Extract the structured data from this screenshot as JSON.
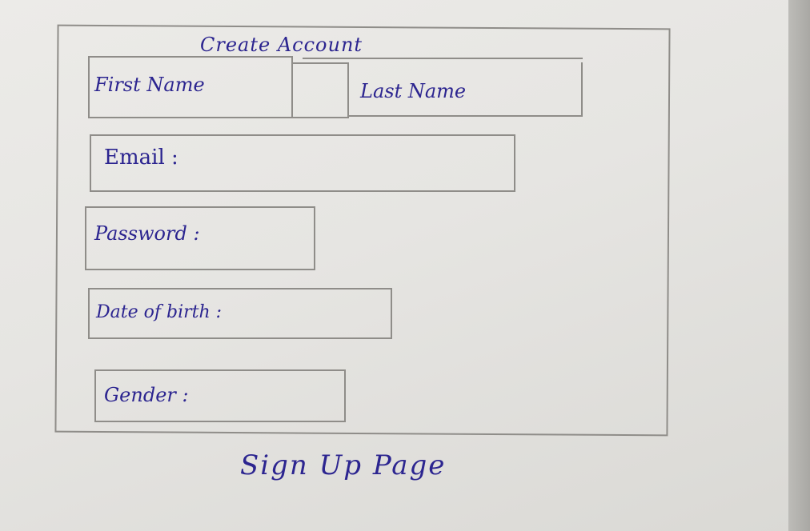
{
  "form": {
    "title": "Create Account",
    "fields": {
      "first_name": "First Name",
      "last_name": "Last Name",
      "email": "Email :",
      "password": "Password :",
      "date_of_birth": "Date of birth :",
      "gender": "Gender :"
    }
  },
  "caption": "Sign Up Page",
  "colors": {
    "ink": "#2c2590",
    "pencil": "#8f8d89",
    "paper": "#e6e5e2"
  }
}
